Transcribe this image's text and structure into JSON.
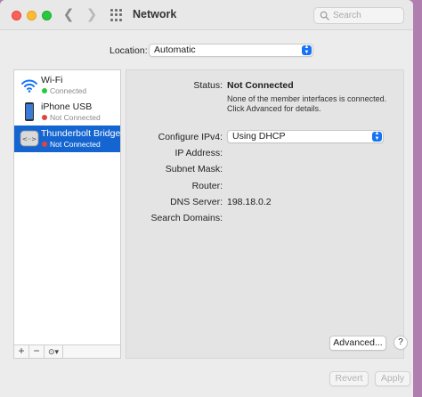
{
  "window": {
    "title": "Network"
  },
  "search": {
    "placeholder": "Search"
  },
  "location": {
    "label": "Location:",
    "value": "Automatic"
  },
  "services": [
    {
      "name": "Wi-Fi",
      "status": "Connected",
      "status_color": "#28c840",
      "icon": "wifi-icon"
    },
    {
      "name": "iPhone USB",
      "status": "Not Connected",
      "status_color": "#e0443e",
      "icon": "iphone-icon"
    },
    {
      "name": "Thunderbolt Bridge",
      "status": "Not Connected",
      "status_color": "#e0443e",
      "icon": "thunderbolt-bridge-icon",
      "selected": true
    }
  ],
  "sidebar_controls": {
    "add": "+",
    "remove": "−",
    "gear": "⊙▾"
  },
  "detail": {
    "status_label": "Status:",
    "status_value": "Not Connected",
    "status_note": "None of the member interfaces is connected. Click Advanced for details.",
    "configure_label": "Configure IPv4:",
    "configure_value": "Using DHCP",
    "ip_label": "IP Address:",
    "subnet_label": "Subnet Mask:",
    "router_label": "Router:",
    "dns_label": "DNS Server:",
    "dns_value": "198.18.0.2",
    "search_domains_label": "Search Domains:"
  },
  "buttons": {
    "advanced": "Advanced...",
    "help": "?",
    "revert": "Revert",
    "apply": "Apply"
  },
  "colors": {
    "accent": "#1673f6",
    "selection": "#1565d1"
  }
}
